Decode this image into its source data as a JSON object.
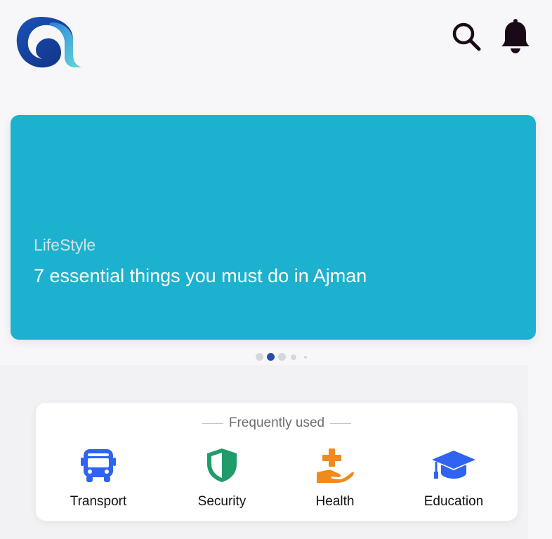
{
  "header": {
    "logo": "app-logo",
    "icons": [
      "search-icon",
      "bell-icon"
    ],
    "colors": {
      "icon": "#1a0a17",
      "logo_dark": "#163c9e",
      "logo_light": "#55d1d8"
    }
  },
  "banner": {
    "category": "LifeStyle",
    "title": "7 essential things you must do in Ajman",
    "background": "#1cb1cf",
    "carousel": {
      "slide_count": 5,
      "active_index": 1
    }
  },
  "frequently_used": {
    "title": "Frequently used",
    "items": [
      {
        "label": "Transport",
        "icon": "bus-icon",
        "color": "#2f63f2"
      },
      {
        "label": "Security",
        "icon": "shield-icon",
        "color": "#1f9c6a"
      },
      {
        "label": "Health",
        "icon": "health-hand-icon",
        "color": "#f08a1d"
      },
      {
        "label": "Education",
        "icon": "graduation-cap-icon",
        "color": "#2f63f2"
      }
    ]
  }
}
